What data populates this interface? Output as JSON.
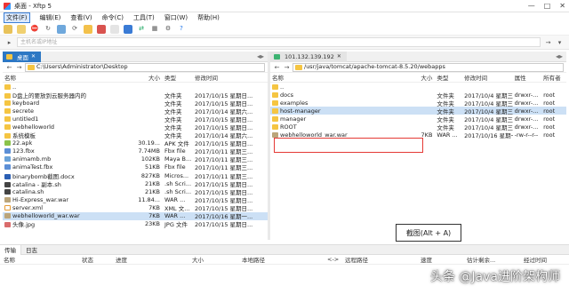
{
  "window": {
    "title": "桌面 - Xftp 5",
    "controls": [
      "—",
      "□",
      "✕"
    ]
  },
  "menu": [
    "文件(F)",
    "编辑(E)",
    "查看(V)",
    "命令(C)",
    "工具(T)",
    "窗口(W)",
    "帮助(H)"
  ],
  "address": {
    "placeholder": "主机名或IP地址"
  },
  "left": {
    "tab": "桌面",
    "path": "C:\\Users\\Administrator\\Desktop",
    "headers": {
      "name": "名称",
      "size": "大小",
      "type": "类型",
      "date": "修改时间"
    },
    "rows": [
      {
        "icon": "up",
        "name": "..",
        "size": "",
        "type": "",
        "date": ""
      },
      {
        "icon": "folder",
        "name": "D盘上的要放到云服务器内的",
        "size": "",
        "type": "文件夹",
        "date": "2017/10/15 星期日..."
      },
      {
        "icon": "folder",
        "name": "keyboard",
        "size": "",
        "type": "文件夹",
        "date": "2017/10/15 星期日..."
      },
      {
        "icon": "folder",
        "name": "secrete",
        "size": "",
        "type": "文件夹",
        "date": "2017/10/14 星期六..."
      },
      {
        "icon": "folder",
        "name": "untitled1",
        "size": "",
        "type": "文件夹",
        "date": "2017/10/15 星期日..."
      },
      {
        "icon": "folder",
        "name": "webhelloworld",
        "size": "",
        "type": "文件夹",
        "date": "2017/10/15 星期日..."
      },
      {
        "icon": "folder",
        "name": "系统模板",
        "size": "",
        "type": "文件夹",
        "date": "2017/10/14 星期六..."
      },
      {
        "icon": "apk",
        "name": "22.apk",
        "size": "30.19...",
        "type": "APK 文件",
        "date": "2017/10/15 星期日..."
      },
      {
        "icon": "fbx",
        "name": "123.fbx",
        "size": "7.74MB",
        "type": "Fbx file",
        "date": "2017/10/11 星期三..."
      },
      {
        "icon": "mb",
        "name": "animamb.mb",
        "size": "102KB",
        "type": "Maya B...",
        "date": "2017/10/11 星期三..."
      },
      {
        "icon": "fbx",
        "name": "animaTest.fbx",
        "size": "51KB",
        "type": "Fbx file",
        "date": "2017/10/11 星期三..."
      },
      {
        "icon": "doc",
        "name": "binarybomb截图.docx",
        "size": "827KB",
        "type": "Micros...",
        "date": "2017/10/11 星期三..."
      },
      {
        "icon": "sh",
        "name": "catalina - 副本.sh",
        "size": "21KB",
        "type": ".sh Scri...",
        "date": "2017/10/15 星期日..."
      },
      {
        "icon": "sh",
        "name": "catalina.sh",
        "size": "21KB",
        "type": ".sh Scri...",
        "date": "2017/10/15 星期日..."
      },
      {
        "icon": "war",
        "name": "Hi-Express_war.war",
        "size": "11.84...",
        "type": "WAR ...",
        "date": "2017/10/15 星期日..."
      },
      {
        "icon": "xml",
        "name": "server.xml",
        "size": "7KB",
        "type": "XML 文...",
        "date": "2017/10/15 星期日..."
      },
      {
        "icon": "war",
        "name": "webhelloworld_war.war",
        "size": "7KB",
        "type": "WAR ...",
        "date": "2017/10/16 星期一...",
        "selected": true
      },
      {
        "icon": "jpg",
        "name": "头像.jpg",
        "size": "23KB",
        "type": "JPG 文件",
        "date": "2017/10/15 星期日..."
      }
    ]
  },
  "right": {
    "tab": "101.132.139.192",
    "path": "/usr/java/tomcat/apache-tomcat-8.5.20/webapps",
    "headers": {
      "name": "名称",
      "size": "大小",
      "type": "类型",
      "date": "修改时间",
      "perm": "属性",
      "owner": "所有者"
    },
    "rows": [
      {
        "icon": "up",
        "name": "..",
        "size": "",
        "type": "",
        "date": "",
        "perm": "",
        "owner": ""
      },
      {
        "icon": "folder",
        "name": "docs",
        "size": "",
        "type": "文件夹",
        "date": "2017/10/4 星期三...",
        "perm": "drwxr-...",
        "owner": "root"
      },
      {
        "icon": "folder",
        "name": "examples",
        "size": "",
        "type": "文件夹",
        "date": "2017/10/4 星期三...",
        "perm": "drwxr-...",
        "owner": "root"
      },
      {
        "icon": "folder",
        "name": "host-manager",
        "size": "",
        "type": "文件夹",
        "date": "2017/10/4 星期三...",
        "perm": "drwxr-...",
        "owner": "root",
        "selected": true
      },
      {
        "icon": "folder",
        "name": "manager",
        "size": "",
        "type": "文件夹",
        "date": "2017/10/4 星期三...",
        "perm": "drwxr-...",
        "owner": "root"
      },
      {
        "icon": "folder",
        "name": "ROOT",
        "size": "",
        "type": "文件夹",
        "date": "2017/10/4 星期三...",
        "perm": "drwxr-...",
        "owner": "root"
      },
      {
        "icon": "war",
        "name": "webhelloworld_war.war",
        "size": "7KB",
        "type": "WAR ...",
        "date": "2017/10/16 星期一...",
        "perm": "-rw-r--r--",
        "owner": "root"
      }
    ]
  },
  "tooltip": "截图(Alt + A)",
  "transfer": {
    "tabs": [
      "传输",
      "日志"
    ],
    "headers": [
      "名称",
      "状态",
      "进度",
      "大小",
      "本地路径",
      "<->",
      "远程路径",
      "速度",
      "估计剩余...",
      "经过时间"
    ]
  },
  "watermark": "头条 @Java进阶架构师"
}
